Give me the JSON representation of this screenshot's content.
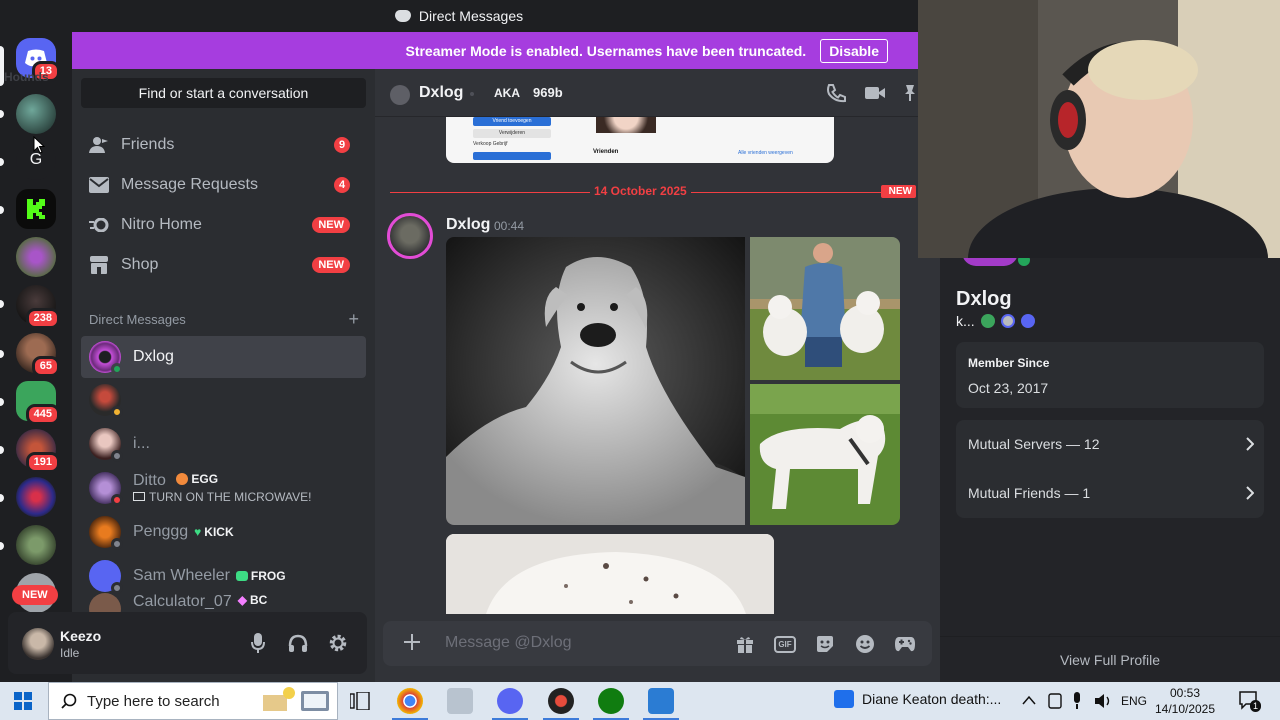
{
  "window": {
    "title": "Direct Messages"
  },
  "banner": {
    "text": "Streamer Mode is enabled. Usernames have been truncated.",
    "button": "Disable"
  },
  "rail": {
    "badges": [
      "13",
      "238",
      "65",
      "445",
      "191"
    ],
    "letter": "G",
    "new_label": "NEW"
  },
  "sidebar": {
    "search_label": "Find or start a conversation",
    "ghost_label": "Hounds",
    "nav": [
      {
        "label": "Friends",
        "count": "9",
        "icon": "friends-icon"
      },
      {
        "label": "Message Requests",
        "count": "4",
        "icon": "mail-icon"
      },
      {
        "label": "Nitro Home",
        "badge": "NEW",
        "icon": "nitro-icon"
      },
      {
        "label": "Shop",
        "badge": "NEW",
        "icon": "shop-icon"
      }
    ],
    "dm_header": "Direct Messages",
    "dm_add": "+",
    "dms": [
      {
        "name": "Dxlog"
      },
      {
        "name": ""
      },
      {
        "name": "i..."
      },
      {
        "name": "Ditto",
        "tag": "EGG",
        "status": "TURN ON THE MICROWAVE!"
      },
      {
        "name": "Penggg",
        "tag": "KICK"
      },
      {
        "name": "Sam Wheeler",
        "tag": "FROG"
      },
      {
        "name": "Calculator_07",
        "tag": "BC"
      }
    ]
  },
  "user": {
    "name": "Keezo",
    "status": "Idle"
  },
  "chat": {
    "header": {
      "name": "Dxlog",
      "aka_label": "AKA",
      "aka_value": "969b"
    },
    "preview": {
      "btn1": "Vriend toevoegen",
      "btn2": "Verwijderen",
      "label": "Vrienden",
      "link": "Alle vrienden weergeven",
      "side": "Verkoop Gebrijf"
    },
    "divider": {
      "date": "14 October 2025",
      "new": "NEW"
    },
    "message": {
      "author": "Dxlog",
      "time": "00:44"
    },
    "composer": {
      "placeholder": "Message @Dxlog",
      "gif": "GIF"
    }
  },
  "profile": {
    "name": "Dxlog",
    "handle": "k...",
    "member_since_label": "Member Since",
    "member_since": "Oct 23, 2017",
    "mutual_servers": "Mutual Servers — 12",
    "mutual_friends": "Mutual Friends — 1",
    "view_full": "View Full Profile"
  },
  "taskbar": {
    "search_placeholder": "Type here to search",
    "news": "Diane Keaton death:...",
    "lang": "ENG",
    "time": "00:53",
    "date": "14/10/2025",
    "notif": "1"
  },
  "colors": {
    "blurple": "#5865f2",
    "red": "#f23f43",
    "streamer": "#a63ddf",
    "online": "#23a55a"
  }
}
